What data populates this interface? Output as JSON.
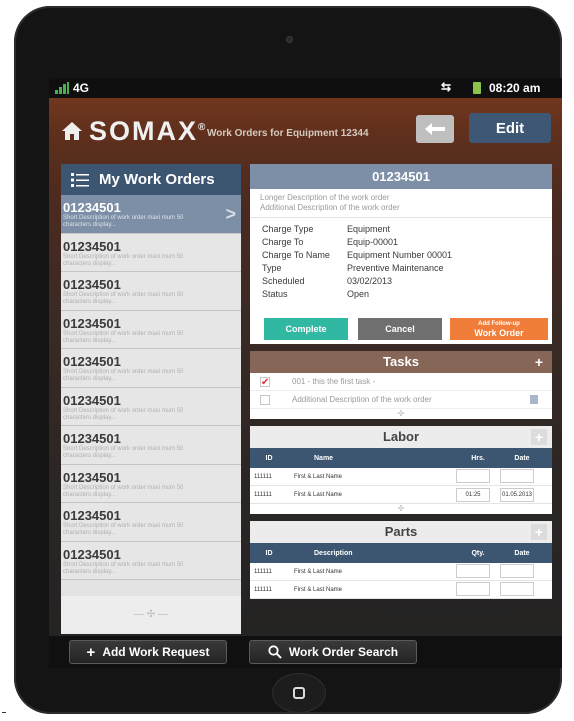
{
  "status": {
    "network": "4G",
    "time": "08:20 am"
  },
  "header": {
    "logo": "SOMAX",
    "subtitle": "Work Orders for Equipment 12344",
    "edit_label": "Edit"
  },
  "sidebar": {
    "title": "My Work Orders",
    "items": [
      {
        "number": "01234501",
        "desc": "Short Description of work order maxi mum 50 characters display..."
      },
      {
        "number": "01234501",
        "desc": "Short Description of work order maxi mum 50 characters display..."
      },
      {
        "number": "01234501",
        "desc": "Short Description of work order maxi mum 50 characters display..."
      },
      {
        "number": "01234501",
        "desc": "Short Description of work order maxi mum 50 characters display..."
      },
      {
        "number": "01234501",
        "desc": "Short Description of work order maxi mum 50 characters display..."
      },
      {
        "number": "01234501",
        "desc": "Short Description of work order maxi mum 50 characters display..."
      },
      {
        "number": "01234501",
        "desc": "Short Description of work order maxi mum 50 characters display..."
      },
      {
        "number": "01234501",
        "desc": "Short Description of work order maxi mum 50 characters display..."
      },
      {
        "number": "01234501",
        "desc": "Short Description of work order maxi mum 50 characters display..."
      },
      {
        "number": "01234501",
        "desc": "Short Description of work order maxi mum 50 characters display..."
      }
    ]
  },
  "detail": {
    "number": "01234501",
    "long_desc_1": "Longer Description of the work order",
    "long_desc_2": "Additional Description of the work order",
    "fields": [
      {
        "label": "Charge Type",
        "value": "Equipment"
      },
      {
        "label": "Charge To",
        "value": "Equip-00001"
      },
      {
        "label": "Charge To Name",
        "value": "Equipment Number 00001"
      },
      {
        "label": "Type",
        "value": "Preventive Maintenance"
      },
      {
        "label": "Scheduled",
        "value": "03/02/2013"
      },
      {
        "label": "Status",
        "value": "Open"
      }
    ],
    "complete_label": "Complete",
    "cancel_label": "Cancel",
    "followup_top": "Add Follow-up",
    "followup_bottom": "Work Order"
  },
  "tasks": {
    "title": "Tasks",
    "items": [
      {
        "text": "001 - this the first task -",
        "checked": true
      },
      {
        "text": "Additional Description of the work order",
        "checked": false
      }
    ]
  },
  "labor": {
    "title": "Labor",
    "headers": {
      "id": "ID",
      "name": "Name",
      "hrs": "Hrs.",
      "date": "Date"
    },
    "rows": [
      {
        "id": "111111",
        "name": "First & Last Name",
        "hrs": "",
        "date": ""
      },
      {
        "id": "111111",
        "name": "First & Last Name",
        "hrs": "01:25",
        "date": "01.05.2013"
      }
    ]
  },
  "parts": {
    "title": "Parts",
    "headers": {
      "id": "ID",
      "desc": "Description",
      "qty": "Qty.",
      "date": "Date"
    },
    "rows": [
      {
        "id": "111111",
        "desc": "First & Last Name"
      },
      {
        "id": "111111",
        "desc": "First & Last Name"
      }
    ]
  },
  "bottom": {
    "add_request_label": "Add Work Request",
    "search_label": "Work Order Search"
  }
}
